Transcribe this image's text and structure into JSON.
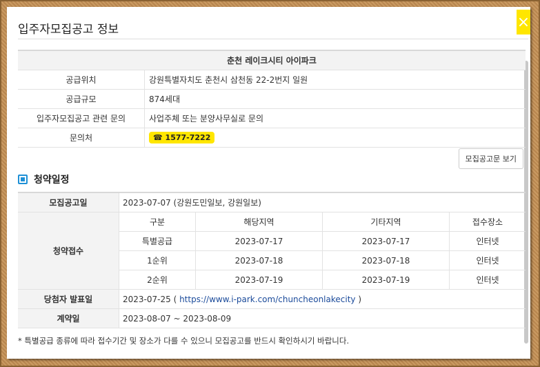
{
  "window": {
    "title": "입주자모집공고 정보",
    "close_label": "×"
  },
  "info": {
    "complex_name": "춘천 레이크시티 아이파크",
    "rows": [
      {
        "label": "공급위치",
        "value": "강원특별자치도 춘천시 삼천동 22-2번지 일원"
      },
      {
        "label": "공급규모",
        "value": "874세대"
      },
      {
        "label": "입주자모집공고 관련 문의",
        "value": "사업주체 또는 분양사무실로 문의"
      }
    ],
    "contact_label": "문의처",
    "phone_icon": "☎",
    "phone": "1577-7222"
  },
  "notice_button": "모집공고문 보기",
  "schedule": {
    "title": "청약일정",
    "announce_label": "모집공고일",
    "announce_value": "2023-07-07 (강원도민일보, 강원일보)",
    "apply_label": "청약접수",
    "columns": [
      "구분",
      "해당지역",
      "기타지역",
      "접수장소"
    ],
    "rows": [
      [
        "특별공급",
        "2023-07-17",
        "2023-07-17",
        "인터넷"
      ],
      [
        "1순위",
        "2023-07-18",
        "2023-07-18",
        "인터넷"
      ],
      [
        "2순위",
        "2023-07-19",
        "2023-07-19",
        "인터넷"
      ]
    ],
    "winner_label": "당첨자 발표일",
    "winner_date": "2023-07-25",
    "winner_paren_open": " ( ",
    "winner_url": "https://www.i-park.com/chuncheonlakecity",
    "winner_paren_close": " )",
    "contract_label": "계약일",
    "contract_value": "2023-08-07 ~ 2023-08-09"
  },
  "footnote": "* 특별공급 종류에 따라 접수기간 및 장소가 다를 수 있으니 모집공고를 반드시 확인하시기 바랍니다.",
  "colors": {
    "accent_yellow": "#ffe600",
    "section_blue": "#1e90d6",
    "link": "#1a4a9a"
  }
}
